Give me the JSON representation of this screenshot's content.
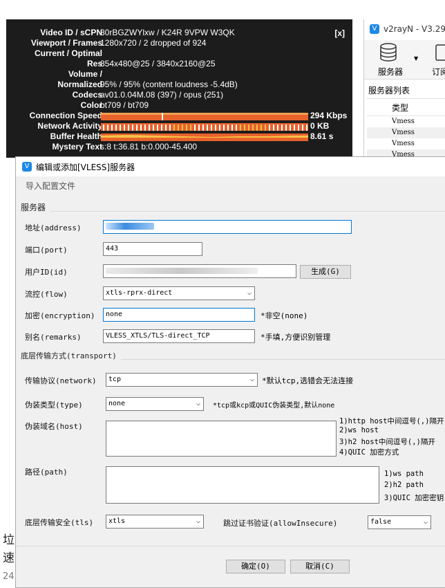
{
  "background_page": {
    "line1": "垃",
    "line2": "速",
    "line3": "24"
  },
  "stats_overlay": {
    "close_label": "[x]",
    "rows": [
      {
        "label": "Video ID / sCPN",
        "value": "80rBGZWYlxw / K24R 9VPW W3QK"
      },
      {
        "label": "Viewport / Frames",
        "value": "1280x720 / 2 dropped of 924"
      },
      {
        "label": "Current / Optimal",
        "value": ""
      },
      {
        "label": "Res",
        "value": "854x480@25 / 3840x2160@25"
      },
      {
        "label": "Volume /",
        "value": ""
      },
      {
        "label": "Normalized",
        "value": "95% / 95% (content loudness -5.4dB)"
      },
      {
        "label": "Codecs",
        "value": "av01.0.04M.08 (397) / opus (251)"
      },
      {
        "label": "Color",
        "value": "bt709 / bt709"
      },
      {
        "label": "Connection Speed",
        "value": "294 Kbps"
      },
      {
        "label": "Network Activity",
        "value": "0 KB"
      },
      {
        "label": "Buffer Health",
        "value": "8.61 s"
      },
      {
        "label": "Mystery Text",
        "value": "s:8 t:36.81 b:0.000-45.400"
      }
    ],
    "colors": {
      "bar_orange": "#e8622c",
      "bar_light": "#f0a050",
      "bar_yellow": "#f6c346"
    }
  },
  "v2rayn": {
    "title": "v2rayN - V3.29",
    "toolbar": {
      "servers_label": "服务器",
      "subscribe_label": "订阅"
    },
    "list_title": "服务器列表",
    "column_type": "类型",
    "rows": [
      "Vmess",
      "Vmess",
      "Vmess",
      "Vmess"
    ]
  },
  "dialog": {
    "title": "编辑或添加[VLESS]服务器",
    "menu_import": "导入配置文件",
    "group_server": "服务器",
    "address_label": "地址(address)",
    "address_value": "",
    "port_label": "端口(port)",
    "port_value": "443",
    "id_label": "用户ID(id)",
    "generate_button": "生成(G)",
    "flow_label": "流控(flow)",
    "flow_value": "xtls-rprx-direct",
    "encryption_label": "加密(encryption)",
    "encryption_value": "none",
    "encryption_hint": "*非空(none)",
    "remarks_label": "别名(remarks)",
    "remarks_value": "VLESS_XTLS/TLS-direct_TCP",
    "remarks_hint": "*手填,方便识别管理",
    "group_transport": "底层传输方式(transport)",
    "network_label": "传输协议(network)",
    "network_value": "tcp",
    "network_hint": "*默认tcp,选错会无法连接",
    "type_label": "伪装类型(type)",
    "type_value": "none",
    "type_hint": "*tcp或kcp或QUIC伪装类型,默认none",
    "host_label": "伪装域名(host)",
    "host_hints": [
      "1)http host中间逗号(,)隔开",
      "2)ws host",
      "3)h2 host中间逗号(,)隔开",
      "4)QUIC 加密方式"
    ],
    "path_label": "路径(path)",
    "path_hints": [
      "1)ws path",
      "2)h2 path",
      "3)QUIC 加密密钥"
    ],
    "tls_label": "底层传输安全(tls)",
    "tls_value": "xtls",
    "allow_insecure_label": "跳过证书验证(allowInsecure)",
    "allow_insecure_value": "false",
    "ok_button": "确定(O)",
    "cancel_button": "取消(C)"
  }
}
